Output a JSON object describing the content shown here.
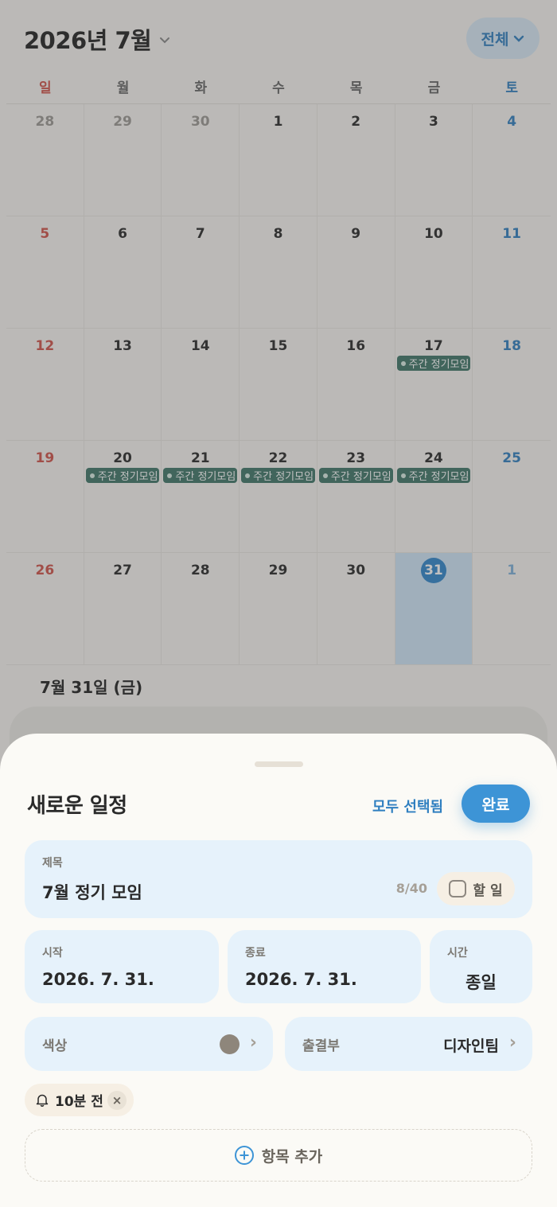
{
  "header": {
    "month_title": "2026년 7월",
    "filter_label": "전체"
  },
  "weekdays": [
    "일",
    "월",
    "화",
    "수",
    "목",
    "금",
    "토"
  ],
  "weeks": [
    [
      {
        "d": "28",
        "o": true
      },
      {
        "d": "29",
        "o": true
      },
      {
        "d": "30",
        "o": true
      },
      {
        "d": "1"
      },
      {
        "d": "2"
      },
      {
        "d": "3"
      },
      {
        "d": "4"
      }
    ],
    [
      {
        "d": "5"
      },
      {
        "d": "6"
      },
      {
        "d": "7"
      },
      {
        "d": "8"
      },
      {
        "d": "9"
      },
      {
        "d": "10"
      },
      {
        "d": "11"
      }
    ],
    [
      {
        "d": "12"
      },
      {
        "d": "13"
      },
      {
        "d": "14"
      },
      {
        "d": "15"
      },
      {
        "d": "16"
      },
      {
        "d": "17",
        "ev": "주간 정기모임"
      },
      {
        "d": "18"
      }
    ],
    [
      {
        "d": "19"
      },
      {
        "d": "20",
        "ev": "주간 정기모임"
      },
      {
        "d": "21",
        "ev": "주간 정기모임"
      },
      {
        "d": "22",
        "ev": "주간 정기모임"
      },
      {
        "d": "23",
        "ev": "주간 정기모임"
      },
      {
        "d": "24",
        "ev": "주간 정기모임"
      },
      {
        "d": "25"
      }
    ],
    [
      {
        "d": "26"
      },
      {
        "d": "27"
      },
      {
        "d": "28"
      },
      {
        "d": "29"
      },
      {
        "d": "30"
      },
      {
        "d": "31",
        "today": true
      },
      {
        "d": "1",
        "o": true
      }
    ]
  ],
  "selected_date": "7월 31일 (금)",
  "sheet": {
    "title": "새로운 일정",
    "select_all": "모두 선택됨",
    "done": "완료",
    "title_field": {
      "label": "제목",
      "value": "7월 정기 모임",
      "counter": "8/40",
      "todo_label": "할 일"
    },
    "start": {
      "label": "시작",
      "value": "2026. 7. 31."
    },
    "end": {
      "label": "종료",
      "value": "2026. 7. 31."
    },
    "time": {
      "label": "시간",
      "value": "종일"
    },
    "color": {
      "label": "색상",
      "value_hex": "#8e867b"
    },
    "calendar": {
      "label": "출결부",
      "value": "디자인팀"
    },
    "alarm": {
      "label": "10분 전"
    },
    "add_item": "항목 추가"
  },
  "colors": {
    "accent": "#3d94d6",
    "event": "#3f7568",
    "sunday": "#d0524a",
    "saturday": "#2f7fc0"
  }
}
